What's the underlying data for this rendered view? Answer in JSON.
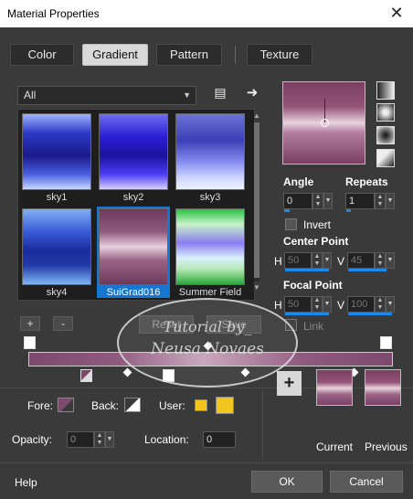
{
  "window": {
    "title": "Material Properties",
    "close_icon": "close-icon"
  },
  "tabs": [
    {
      "label": "Color",
      "active": false
    },
    {
      "label": "Gradient",
      "active": true
    },
    {
      "label": "Pattern",
      "active": false
    },
    {
      "label": "Texture",
      "active": false
    }
  ],
  "library": {
    "category": "All",
    "items": [
      {
        "label": "sky1",
        "colors": [
          "#9fb5ff",
          "#2d3ac8",
          "#1a1a8a",
          "#4a5ee0",
          "#c8d7ff"
        ],
        "selected": false
      },
      {
        "label": "sky2",
        "colors": [
          "#6f6ef0",
          "#2a1fd6",
          "#1b129f",
          "#4b3cf2",
          "#d6d0ff"
        ],
        "selected": false
      },
      {
        "label": "sky3",
        "colors": [
          "#6a74d6",
          "#3b3fb6",
          "#8a92f2",
          "#cfd6ff",
          "#eef2ff"
        ],
        "selected": false
      },
      {
        "label": "sky4",
        "colors": [
          "#7fb0f0",
          "#3a5bd8",
          "#1a2b9a",
          "#223aa8",
          "#7fb4f4"
        ],
        "selected": false
      },
      {
        "label": "SuiGrad016",
        "colors": [
          "#6d3a5c",
          "#8f5a7e",
          "#e8d0dc",
          "#9a6487",
          "#6d3a5c"
        ],
        "selected": true
      },
      {
        "label": "Summer Field",
        "colors": [
          "#27c241",
          "#c9f2c9",
          "#8a7cf2",
          "#d9f0f9",
          "#2aa83a"
        ],
        "selected": false
      }
    ],
    "add_label": "+",
    "remove_label": "-",
    "reset_label": "Reset",
    "save_label": "Save"
  },
  "properties": {
    "angle_label": "Angle",
    "angle_value": "0",
    "repeats_label": "Repeats",
    "repeats_value": "1",
    "invert_label": "Invert",
    "invert_checked": false,
    "center_point_label": "Center Point",
    "center_h_label": "H",
    "center_h_value": "50",
    "center_v_label": "V",
    "center_v_value": "45",
    "focal_point_label": "Focal Point",
    "focal_h_label": "H",
    "focal_h_value": "50",
    "focal_v_label": "V",
    "focal_v_value": "100",
    "link_label": "Link"
  },
  "gradient_types": [
    "linear-icon",
    "rectangular-icon",
    "sunburst-icon",
    "radial-icon"
  ],
  "editor": {
    "fore_label": "Fore:",
    "back_label": "Back:",
    "user_label": "User:",
    "opacity_label": "Opacity:",
    "opacity_value": "0",
    "location_label": "Location:",
    "location_value": "0",
    "user_color": "#f2c51c",
    "fore_color": "#7d4a6d",
    "back_color": "#ffffff"
  },
  "history": {
    "add_label": "+",
    "current_label": "Current",
    "previous_label": "Previous"
  },
  "watermark": {
    "line1": "Tutorial by_",
    "line2": "Neusa Novaes"
  },
  "footer": {
    "help_label": "Help",
    "ok_label": "OK",
    "cancel_label": "Cancel"
  }
}
